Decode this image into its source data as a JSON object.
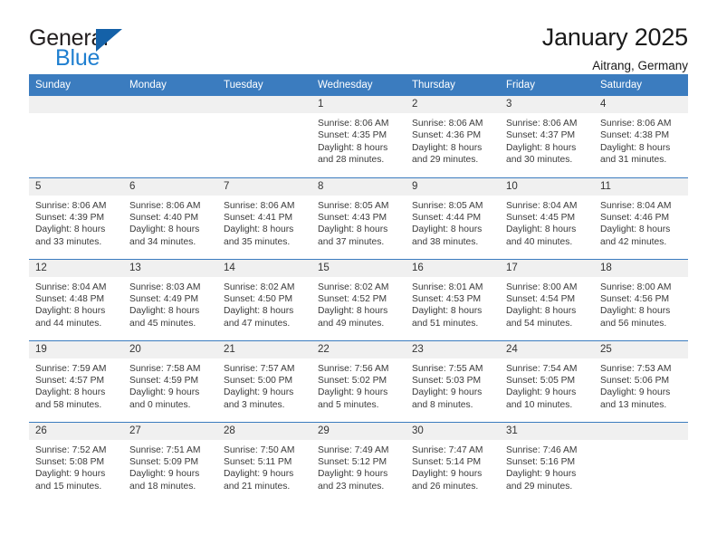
{
  "brand": {
    "name_primary": "General",
    "name_secondary": "Blue",
    "accent_color": "#1f7fd0",
    "triangle_color": "#1461a8"
  },
  "header": {
    "title": "January 2025",
    "subtitle": "Aitrang, Germany",
    "header_bg": "#3b7cbf"
  },
  "weekday_headers": [
    "Sunday",
    "Monday",
    "Tuesday",
    "Wednesday",
    "Thursday",
    "Friday",
    "Saturday"
  ],
  "weeks": [
    [
      {
        "day": "",
        "lines": []
      },
      {
        "day": "",
        "lines": []
      },
      {
        "day": "",
        "lines": []
      },
      {
        "day": "1",
        "lines": [
          "Sunrise: 8:06 AM",
          "Sunset: 4:35 PM",
          "Daylight: 8 hours",
          "and 28 minutes."
        ]
      },
      {
        "day": "2",
        "lines": [
          "Sunrise: 8:06 AM",
          "Sunset: 4:36 PM",
          "Daylight: 8 hours",
          "and 29 minutes."
        ]
      },
      {
        "day": "3",
        "lines": [
          "Sunrise: 8:06 AM",
          "Sunset: 4:37 PM",
          "Daylight: 8 hours",
          "and 30 minutes."
        ]
      },
      {
        "day": "4",
        "lines": [
          "Sunrise: 8:06 AM",
          "Sunset: 4:38 PM",
          "Daylight: 8 hours",
          "and 31 minutes."
        ]
      }
    ],
    [
      {
        "day": "5",
        "lines": [
          "Sunrise: 8:06 AM",
          "Sunset: 4:39 PM",
          "Daylight: 8 hours",
          "and 33 minutes."
        ]
      },
      {
        "day": "6",
        "lines": [
          "Sunrise: 8:06 AM",
          "Sunset: 4:40 PM",
          "Daylight: 8 hours",
          "and 34 minutes."
        ]
      },
      {
        "day": "7",
        "lines": [
          "Sunrise: 8:06 AM",
          "Sunset: 4:41 PM",
          "Daylight: 8 hours",
          "and 35 minutes."
        ]
      },
      {
        "day": "8",
        "lines": [
          "Sunrise: 8:05 AM",
          "Sunset: 4:43 PM",
          "Daylight: 8 hours",
          "and 37 minutes."
        ]
      },
      {
        "day": "9",
        "lines": [
          "Sunrise: 8:05 AM",
          "Sunset: 4:44 PM",
          "Daylight: 8 hours",
          "and 38 minutes."
        ]
      },
      {
        "day": "10",
        "lines": [
          "Sunrise: 8:04 AM",
          "Sunset: 4:45 PM",
          "Daylight: 8 hours",
          "and 40 minutes."
        ]
      },
      {
        "day": "11",
        "lines": [
          "Sunrise: 8:04 AM",
          "Sunset: 4:46 PM",
          "Daylight: 8 hours",
          "and 42 minutes."
        ]
      }
    ],
    [
      {
        "day": "12",
        "lines": [
          "Sunrise: 8:04 AM",
          "Sunset: 4:48 PM",
          "Daylight: 8 hours",
          "and 44 minutes."
        ]
      },
      {
        "day": "13",
        "lines": [
          "Sunrise: 8:03 AM",
          "Sunset: 4:49 PM",
          "Daylight: 8 hours",
          "and 45 minutes."
        ]
      },
      {
        "day": "14",
        "lines": [
          "Sunrise: 8:02 AM",
          "Sunset: 4:50 PM",
          "Daylight: 8 hours",
          "and 47 minutes."
        ]
      },
      {
        "day": "15",
        "lines": [
          "Sunrise: 8:02 AM",
          "Sunset: 4:52 PM",
          "Daylight: 8 hours",
          "and 49 minutes."
        ]
      },
      {
        "day": "16",
        "lines": [
          "Sunrise: 8:01 AM",
          "Sunset: 4:53 PM",
          "Daylight: 8 hours",
          "and 51 minutes."
        ]
      },
      {
        "day": "17",
        "lines": [
          "Sunrise: 8:00 AM",
          "Sunset: 4:54 PM",
          "Daylight: 8 hours",
          "and 54 minutes."
        ]
      },
      {
        "day": "18",
        "lines": [
          "Sunrise: 8:00 AM",
          "Sunset: 4:56 PM",
          "Daylight: 8 hours",
          "and 56 minutes."
        ]
      }
    ],
    [
      {
        "day": "19",
        "lines": [
          "Sunrise: 7:59 AM",
          "Sunset: 4:57 PM",
          "Daylight: 8 hours",
          "and 58 minutes."
        ]
      },
      {
        "day": "20",
        "lines": [
          "Sunrise: 7:58 AM",
          "Sunset: 4:59 PM",
          "Daylight: 9 hours",
          "and 0 minutes."
        ]
      },
      {
        "day": "21",
        "lines": [
          "Sunrise: 7:57 AM",
          "Sunset: 5:00 PM",
          "Daylight: 9 hours",
          "and 3 minutes."
        ]
      },
      {
        "day": "22",
        "lines": [
          "Sunrise: 7:56 AM",
          "Sunset: 5:02 PM",
          "Daylight: 9 hours",
          "and 5 minutes."
        ]
      },
      {
        "day": "23",
        "lines": [
          "Sunrise: 7:55 AM",
          "Sunset: 5:03 PM",
          "Daylight: 9 hours",
          "and 8 minutes."
        ]
      },
      {
        "day": "24",
        "lines": [
          "Sunrise: 7:54 AM",
          "Sunset: 5:05 PM",
          "Daylight: 9 hours",
          "and 10 minutes."
        ]
      },
      {
        "day": "25",
        "lines": [
          "Sunrise: 7:53 AM",
          "Sunset: 5:06 PM",
          "Daylight: 9 hours",
          "and 13 minutes."
        ]
      }
    ],
    [
      {
        "day": "26",
        "lines": [
          "Sunrise: 7:52 AM",
          "Sunset: 5:08 PM",
          "Daylight: 9 hours",
          "and 15 minutes."
        ]
      },
      {
        "day": "27",
        "lines": [
          "Sunrise: 7:51 AM",
          "Sunset: 5:09 PM",
          "Daylight: 9 hours",
          "and 18 minutes."
        ]
      },
      {
        "day": "28",
        "lines": [
          "Sunrise: 7:50 AM",
          "Sunset: 5:11 PM",
          "Daylight: 9 hours",
          "and 21 minutes."
        ]
      },
      {
        "day": "29",
        "lines": [
          "Sunrise: 7:49 AM",
          "Sunset: 5:12 PM",
          "Daylight: 9 hours",
          "and 23 minutes."
        ]
      },
      {
        "day": "30",
        "lines": [
          "Sunrise: 7:47 AM",
          "Sunset: 5:14 PM",
          "Daylight: 9 hours",
          "and 26 minutes."
        ]
      },
      {
        "day": "31",
        "lines": [
          "Sunrise: 7:46 AM",
          "Sunset: 5:16 PM",
          "Daylight: 9 hours",
          "and 29 minutes."
        ]
      },
      {
        "day": "",
        "lines": []
      }
    ]
  ]
}
